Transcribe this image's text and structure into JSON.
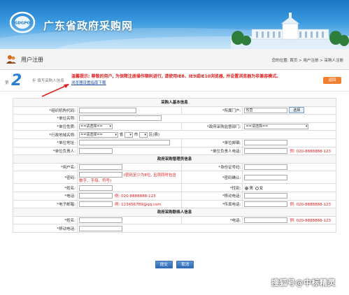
{
  "header": {
    "logo_text": "GDGPO",
    "site_title": "广东省政府采购网"
  },
  "subheader": {
    "page_title": "用户注册",
    "breadcrumb": "您的位置: 首页 > 用户注册 > 采购人注册"
  },
  "step": {
    "prefix": "第",
    "number": "2",
    "suffix": "步",
    "label": "填写采购人信息",
    "notice": "温馨提示: 尊敬的用户, 为保障注册操作顺利进行, 请使用IE8、IE9或IE10浏览器, 并设置浏览器为非兼容模式。",
    "notice_link": "浏览器设置指南下载",
    "back_button": "返回"
  },
  "form": {
    "section_basic": "采购人基本信息",
    "org_code_label": "*组织机构代码:",
    "region_label": "*所属门户:",
    "region_value": "省直",
    "region_button": "选择",
    "unit_name_label": "*单位名称:",
    "unit_type_label": "*单位性质:",
    "unit_type_value": "==请选择==",
    "supervisor_label": "*政府采购监督部门:",
    "supervisor_value": "==请选择==",
    "admin_region_label": "*行政地域名称:",
    "admin_region_value": "==请选择==",
    "province_suffix": "省",
    "city_suffix": "市",
    "district_suffix": "区(县)",
    "address_label": "*单位地址:",
    "postcode_label": "*单位邮编:",
    "leader_label": "*单位负责人:",
    "leader_phone_label": "*单位负责人电话:",
    "phone_example": "例: 020-8888888-123",
    "section_admin": "政府采购管理员信息",
    "username_label": "*用户名:",
    "id_label": "*身份证号码:",
    "password_label": "*密码:",
    "password_hint_1": "(密码至少为8位, 且须同时包含",
    "password_hint_2": "数字、字母、符号)",
    "confirm_label": "*密码确认:",
    "name_label": "*姓名:",
    "gender_label": "*性别:",
    "gender_male": "男",
    "gender_female": "女",
    "phone_label": "*电话:",
    "mobile_label": "*移动电话:",
    "email_label": "*电子邮箱:",
    "email_example": "例: 123456789@qq.com",
    "fax_label": "*传真电话:",
    "section_contact": "政府采购联络人信息",
    "contact_name_label": "*姓名:",
    "contact_phone_label": "*电话:",
    "contact_mobile_label": "*移动电话:"
  },
  "actions": {
    "submit": "提交",
    "cancel": "取消"
  },
  "watermark": "搜狐号@中标精灵",
  "colors": {
    "banner": "#1a76c4",
    "notice": "#e02020",
    "back_button": "#f08030",
    "action_button": "#2f69b3"
  }
}
